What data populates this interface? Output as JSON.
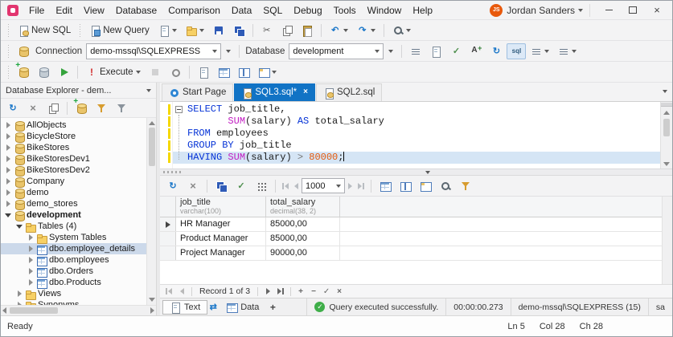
{
  "accent": {
    "tab_active_bg": "#1173c5",
    "keyword_color": "#0633d6",
    "function_color": "#c21ec2",
    "number_color": "#e4590c",
    "success_color": "#3fae49"
  },
  "window": {
    "menu": [
      "File",
      "Edit",
      "View",
      "Database",
      "Comparison",
      "Data",
      "SQL",
      "Debug",
      "Tools",
      "Window",
      "Help"
    ],
    "user_name": "Jordan Sanders",
    "user_initials": "JS"
  },
  "toolbar_main": {
    "new_sql": "New SQL",
    "new_query": "New Query"
  },
  "toolbar_connection": {
    "connection_label": "Connection",
    "connection_value": "demo-mssql\\SQLEXPRESS",
    "database_label": "Database",
    "database_value": "development"
  },
  "toolbar_execute": {
    "execute_label": "Execute"
  },
  "explorer": {
    "title": "Database Explorer - dem...",
    "tree": [
      {
        "label": "AllObjects",
        "level": 0,
        "icon": "db",
        "arrow": "right"
      },
      {
        "label": "BicycleStore",
        "level": 0,
        "icon": "db",
        "arrow": "right"
      },
      {
        "label": "BikeStores",
        "level": 0,
        "icon": "db",
        "arrow": "right"
      },
      {
        "label": "BikeStoresDev1",
        "level": 0,
        "icon": "db",
        "arrow": "right"
      },
      {
        "label": "BikeStoresDev2",
        "level": 0,
        "icon": "db",
        "arrow": "right"
      },
      {
        "label": "Company",
        "level": 0,
        "icon": "db",
        "arrow": "right"
      },
      {
        "label": "demo",
        "level": 0,
        "icon": "db",
        "arrow": "right"
      },
      {
        "label": "demo_stores",
        "level": 0,
        "icon": "db",
        "arrow": "right"
      },
      {
        "label": "development",
        "level": 0,
        "icon": "db",
        "arrow": "down",
        "bold": true
      },
      {
        "label": "Tables (4)",
        "level": 1,
        "icon": "folder",
        "arrow": "down"
      },
      {
        "label": "System Tables",
        "level": 2,
        "icon": "folder",
        "arrow": "right"
      },
      {
        "label": "dbo.employee_details",
        "level": 2,
        "icon": "table",
        "arrow": "right",
        "selected": true
      },
      {
        "label": "dbo.employees",
        "level": 2,
        "icon": "table",
        "arrow": "right"
      },
      {
        "label": "dbo.Orders",
        "level": 2,
        "icon": "table",
        "arrow": "right"
      },
      {
        "label": "dbo.Products",
        "level": 2,
        "icon": "table",
        "arrow": "right"
      },
      {
        "label": "Views",
        "level": 1,
        "icon": "folder",
        "arrow": "right"
      },
      {
        "label": "Synonyms",
        "level": 1,
        "icon": "folder",
        "arrow": "right"
      }
    ]
  },
  "doc_tabs": [
    {
      "label": "Start Page",
      "icon": "start",
      "active": false
    },
    {
      "label": "SQL3.sql*",
      "icon": "sqldoc",
      "active": true,
      "closable": true
    },
    {
      "label": "SQL2.sql",
      "icon": "sqldoc",
      "active": false
    }
  ],
  "editor": {
    "lines": [
      {
        "tokens": [
          {
            "t": "SELECT",
            "c": "kw"
          },
          {
            "t": " job_title,",
            "c": "pl"
          }
        ]
      },
      {
        "tokens": [
          {
            "t": "       ",
            "c": "pl"
          },
          {
            "t": "SUM",
            "c": "fn"
          },
          {
            "t": "(salary) ",
            "c": "pl"
          },
          {
            "t": "AS",
            "c": "kw"
          },
          {
            "t": " total_salary",
            "c": "pl"
          }
        ]
      },
      {
        "tokens": [
          {
            "t": "FROM",
            "c": "kw"
          },
          {
            "t": " employees",
            "c": "pl"
          }
        ]
      },
      {
        "tokens": [
          {
            "t": "GROUP BY",
            "c": "kw"
          },
          {
            "t": " job_title",
            "c": "pl"
          }
        ]
      },
      {
        "tokens": [
          {
            "t": "HAVING",
            "c": "kw"
          },
          {
            "t": " ",
            "c": "pl"
          },
          {
            "t": "SUM",
            "c": "fn"
          },
          {
            "t": "(salary) ",
            "c": "pl"
          },
          {
            "t": ">",
            "c": "op"
          },
          {
            "t": " ",
            "c": "pl"
          },
          {
            "t": "80000",
            "c": "num"
          },
          {
            "t": ";",
            "c": "pl"
          }
        ],
        "current": true
      }
    ]
  },
  "results": {
    "page_size": "1000",
    "record_nav_label": "Record 1 of 3",
    "grid": {
      "columns": [
        {
          "name": "job_title",
          "type": "varchar(100)"
        },
        {
          "name": "total_salary",
          "type": "decimal(38, 2)"
        }
      ],
      "rows": [
        {
          "cells": [
            "HR Manager",
            "85000,00"
          ],
          "current": true
        },
        {
          "cells": [
            "Product Manager",
            "85000,00"
          ]
        },
        {
          "cells": [
            "Project Manager",
            "90000,00"
          ]
        }
      ]
    }
  },
  "bottom": {
    "tab_text": "Text",
    "tab_data": "Data",
    "status_message": "Query executed successfully.",
    "exec_time": "00:00:00.273",
    "server": "demo-mssql\\SQLEXPRESS (15)",
    "user": "sa"
  },
  "statusbar": {
    "state": "Ready",
    "line": "Ln 5",
    "col": "Col 28",
    "ch": "Ch 28"
  }
}
